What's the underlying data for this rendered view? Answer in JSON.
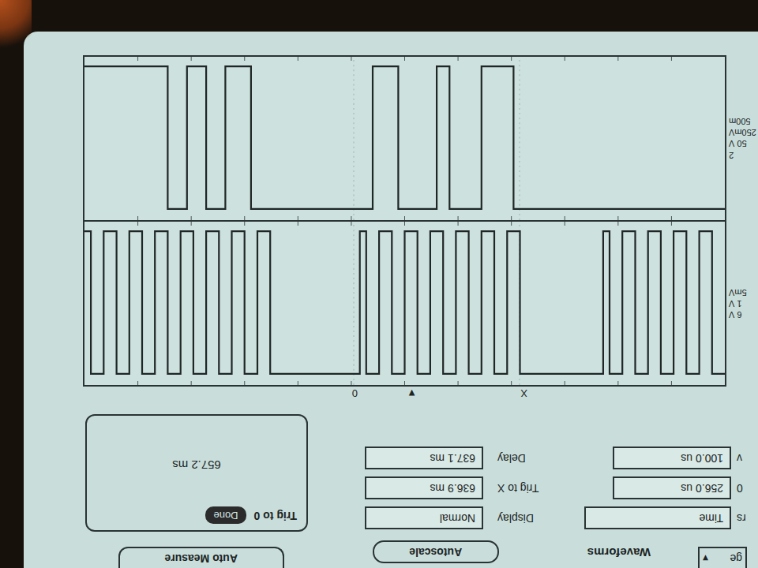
{
  "toolbar": {
    "menu": "ge",
    "menu_arrow": "▾",
    "title": "Waveforms",
    "autoscale": "Autoscale",
    "auto_measure": "Auto Measure"
  },
  "rows": [
    {
      "label": "rs",
      "field": "Time",
      "label2": "Display",
      "field2": "Normal"
    },
    {
      "label": "0",
      "field": "256.0 us",
      "label2": "Trig to X",
      "field2": "636.9 ms"
    },
    {
      "label": "v",
      "field": "100.0 us",
      "label2": "Delay",
      "field2": "637.1 ms"
    }
  ],
  "measure": {
    "title": "Trig to 0",
    "status": "Done",
    "value": "657.2 ms"
  },
  "ruler": {
    "markers": [
      "X",
      "▼",
      "0"
    ]
  },
  "channels": [
    {
      "labels": [
        "6 V",
        "1 V",
        "5mV"
      ],
      "values": [
        1,
        1,
        0,
        0,
        1,
        1,
        0,
        0,
        1,
        1,
        0,
        0,
        1,
        1,
        0,
        0,
        1,
        1,
        0,
        1,
        1,
        1,
        1,
        1,
        1,
        1,
        1,
        1,
        1,
        1,
        1,
        1,
        0,
        0,
        1,
        1,
        0,
        0,
        1,
        1,
        0,
        0,
        1,
        1,
        0,
        0,
        1,
        1,
        0,
        0,
        1,
        1,
        0,
        0,
        1,
        1,
        0,
        1,
        1,
        1,
        1,
        1,
        1,
        1,
        1,
        1,
        1,
        1,
        1,
        1,
        1,
        0,
        0,
        1,
        1,
        0,
        0,
        1,
        1,
        0,
        0,
        1,
        1,
        0,
        0,
        1,
        1,
        0,
        0,
        1,
        1,
        0,
        0,
        1,
        1,
        0,
        0,
        1,
        1,
        0
      ]
    },
    {
      "labels": [
        "2",
        "50 V",
        "250mV",
        "500m"
      ],
      "values": [
        1,
        1,
        1,
        1,
        1,
        1,
        1,
        1,
        1,
        1,
        1,
        1,
        1,
        1,
        1,
        1,
        1,
        1,
        1,
        1,
        1,
        1,
        1,
        1,
        1,
        1,
        1,
        1,
        1,
        1,
        1,
        1,
        1,
        0,
        0,
        0,
        0,
        0,
        1,
        1,
        1,
        1,
        1,
        0,
        0,
        1,
        1,
        1,
        1,
        1,
        1,
        0,
        0,
        0,
        0,
        1,
        1,
        1,
        1,
        1,
        1,
        1,
        1,
        1,
        1,
        1,
        1,
        1,
        1,
        1,
        1,
        1,
        1,
        1,
        0,
        0,
        0,
        0,
        1,
        1,
        1,
        0,
        0,
        0,
        1,
        1,
        1,
        0,
        0,
        0,
        0,
        0,
        0,
        0,
        0,
        0,
        0,
        0,
        0,
        0
      ]
    }
  ]
}
